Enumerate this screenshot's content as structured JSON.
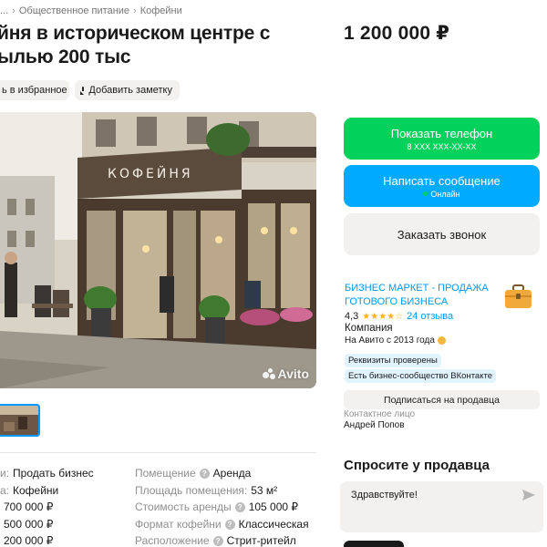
{
  "breadcrumb": {
    "ellipsis": "...",
    "separator": "›",
    "items": [
      "Общественное питание",
      "Кофейни"
    ]
  },
  "listing": {
    "title": "йня в историческом центре с ылью 200 тыс",
    "price": "1 200 000 ₽",
    "favorite_label": "ь в избранное",
    "note_label": "Добавить заметку",
    "photo_sign": "КОФЕЙНЯ",
    "watermark": "Avito"
  },
  "params_left": [
    {
      "label": "и:",
      "value": "Продать бизнес"
    },
    {
      "label": "а:",
      "value": "Кофейни"
    },
    {
      "label": "",
      "value": "700 000 ₽"
    },
    {
      "label": "",
      "value": "500 000 ₽"
    },
    {
      "label": "",
      "value": "200 000 ₽"
    }
  ],
  "params_right": [
    {
      "label": "Помещение",
      "help": "?",
      "value": "Аренда"
    },
    {
      "label": "Площадь помещения:",
      "help": "",
      "value": "53 м²"
    },
    {
      "label": "Стоимость аренды",
      "help": "?",
      "value": "105 000 ₽"
    },
    {
      "label": "Формат кофейни",
      "help": "?",
      "value": "Классическая"
    },
    {
      "label": "Расположение",
      "help": "?",
      "value": "Стрит-ритейл"
    }
  ],
  "actions": {
    "phone_label": "Показать телефон",
    "phone_masked": "8 XXX XXX-XX-XX",
    "message_label": "Написать сообщение",
    "message_status": "Онлайн",
    "call_label": "Заказать звонок"
  },
  "seller": {
    "name": "БИЗНЕС МАРКЕТ - ПРОДАЖА ГОТОВОГО БИЗНЕСА",
    "rating": "4,3",
    "stars": "★★★★☆",
    "reviews": "24 отзыва",
    "type": "Компания",
    "since": "На Авито с 2013 года",
    "badges": [
      "Реквизиты проверены",
      "Есть бизнес-сообщество ВКонтакте"
    ],
    "subscribe_label": "Подписаться на продавца",
    "contact_label": "Контактное лицо",
    "contact_name": "Андрей Попов"
  },
  "ask": {
    "title": "Спросите у продавца",
    "message": "Здравствуйте!"
  },
  "colors": {
    "green": "#02d15c",
    "blue": "#00aaff",
    "link": "#0099f7",
    "star": "#ffb021"
  },
  "icons": [
    "note-icon",
    "help-icon",
    "briefcase-icon",
    "medal-icon",
    "send-icon"
  ]
}
